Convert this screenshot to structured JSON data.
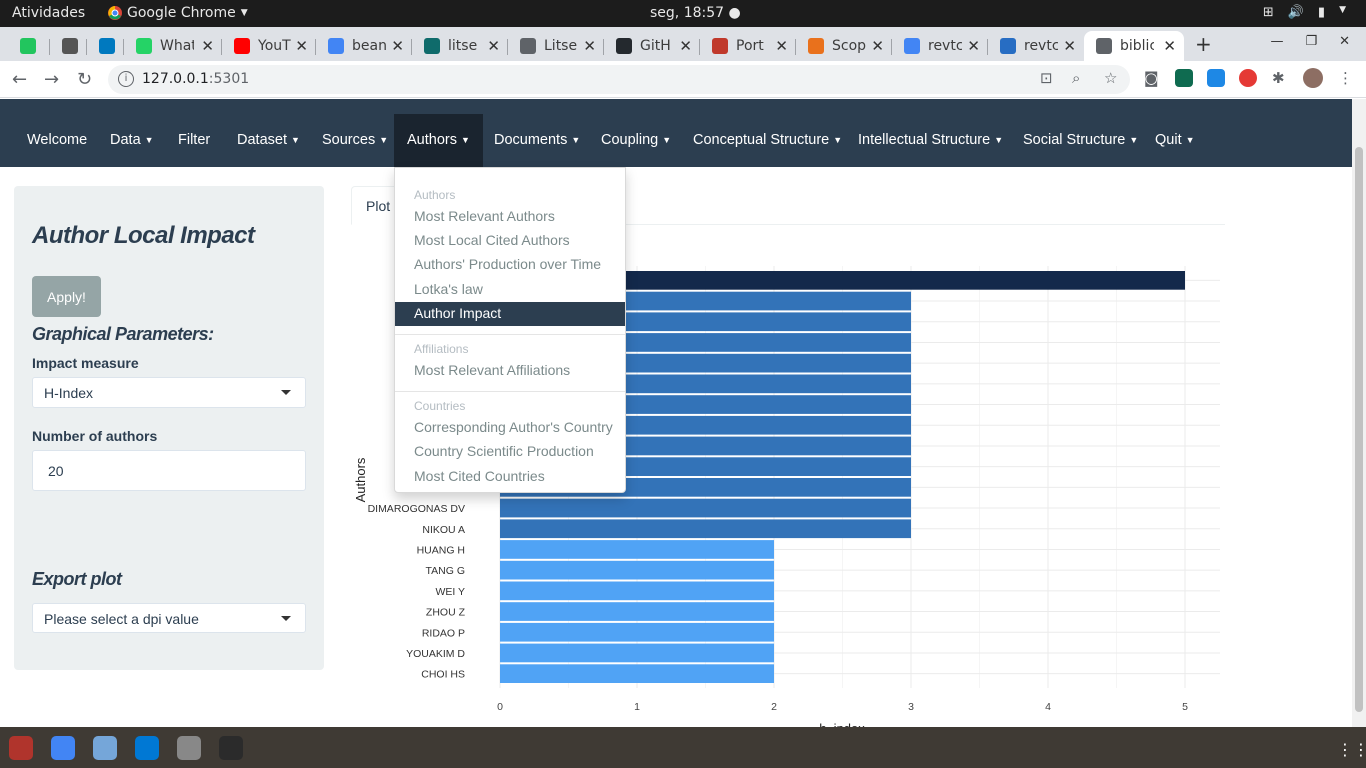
{
  "os": {
    "activities": "Atividades",
    "app": "Google Chrome",
    "clock": "seg, 18:57",
    "app_icon": "chrome-icon"
  },
  "tabs": [
    {
      "label": "",
      "icon": "green-app-icon",
      "color": "#22c55e"
    },
    {
      "label": "",
      "icon": "mendeley-icon",
      "color": "#555555"
    },
    {
      "label": "",
      "icon": "trello-icon",
      "color": "#0079bf"
    },
    {
      "label": "What",
      "icon": "whatsapp-icon",
      "color": "#25d366"
    },
    {
      "label": "YouT",
      "icon": "youtube-icon",
      "color": "#ff0000"
    },
    {
      "label": "bean",
      "icon": "google-icon",
      "color": "#4285f4"
    },
    {
      "label": "litse",
      "icon": "litsearch-icon",
      "color": "#0f6b6b"
    },
    {
      "label": "Litse",
      "icon": "globe-icon",
      "color": "#5f6368"
    },
    {
      "label": "GitH",
      "icon": "github-icon",
      "color": "#24292e"
    },
    {
      "label": "Port",
      "icon": "portal-icon",
      "color": "#c0392b"
    },
    {
      "label": "Scop",
      "icon": "scopus-icon",
      "color": "#e9711c"
    },
    {
      "label": "revtc",
      "icon": "google-icon",
      "color": "#4285f4"
    },
    {
      "label": "revtc",
      "icon": "r-icon",
      "color": "#276dc3"
    },
    {
      "label": "biblic",
      "icon": "globe-icon",
      "color": "#5f6368"
    }
  ],
  "browser": {
    "url_host": "127.0.0.1",
    "url_port": ":5301"
  },
  "navbar": {
    "items": [
      {
        "label": "Welcome",
        "caret": false
      },
      {
        "label": "Data",
        "caret": true
      },
      {
        "label": "Filter",
        "caret": false
      },
      {
        "label": "Dataset",
        "caret": true
      },
      {
        "label": "Sources",
        "caret": true
      },
      {
        "label": "Authors",
        "caret": true
      },
      {
        "label": "Documents",
        "caret": true
      },
      {
        "label": "Coupling",
        "caret": true
      },
      {
        "label": "Conceptual Structure",
        "caret": true
      },
      {
        "label": "Intellectual Structure",
        "caret": true
      },
      {
        "label": "Social Structure",
        "caret": true
      },
      {
        "label": "Quit",
        "caret": true
      }
    ]
  },
  "sidebar": {
    "title": "Author Local Impact",
    "apply": "Apply!",
    "graph_params": "Graphical Parameters:",
    "impact_label": "Impact measure",
    "impact_value": "H-Index",
    "num_label": "Number of authors",
    "num_value": "20",
    "export_label": "Export plot",
    "dpi_placeholder": "Please select a dpi value"
  },
  "plot_tab": "Plot",
  "dropdown": {
    "authors_header": "Authors",
    "items_authors": [
      "Most Relevant Authors",
      "Most Local Cited Authors",
      "Authors' Production over Time",
      "Lotka's law",
      "Author Impact"
    ],
    "affil_header": "Affiliations",
    "items_affil": [
      "Most Relevant Affiliations"
    ],
    "countries_header": "Countries",
    "items_countries": [
      "Corresponding Author's Country",
      "Country Scientific Production",
      "Most Cited Countries"
    ]
  },
  "chart_data": {
    "type": "bar",
    "orientation": "horizontal",
    "xlabel": "h_index",
    "ylabel": "Authors",
    "xlim": [
      0,
      5.2
    ],
    "xticks": [
      "0",
      "1",
      "2",
      "3",
      "4",
      "5"
    ],
    "categories_visible": [
      "DIMAROGONAS DV",
      "NIKOU A",
      "HUANG H",
      "TANG G",
      "WEI Y",
      "ZHOU Z",
      "RIDAO P",
      "YOUAKIM D",
      "CHOI HS"
    ],
    "values_top_to_bottom": [
      5,
      3,
      3,
      3,
      3,
      3,
      3,
      3,
      3,
      3,
      3,
      3,
      3,
      2,
      2,
      2,
      2,
      2,
      2,
      2
    ],
    "colors": {
      "h5": "#13294b",
      "h3": "#3373b8",
      "h2": "#50a3f5"
    }
  },
  "taskbar": [
    {
      "icon": "files-icon",
      "color": "#b0342c"
    },
    {
      "icon": "chrome-icon",
      "color": "#4285f4"
    },
    {
      "icon": "rstudio-icon",
      "color": "#75a6d9"
    },
    {
      "icon": "vscode-icon",
      "color": "#0078d4"
    },
    {
      "icon": "image-viewer-icon",
      "color": "#888888"
    },
    {
      "icon": "terminal-icon",
      "color": "#2b2b2b"
    }
  ]
}
